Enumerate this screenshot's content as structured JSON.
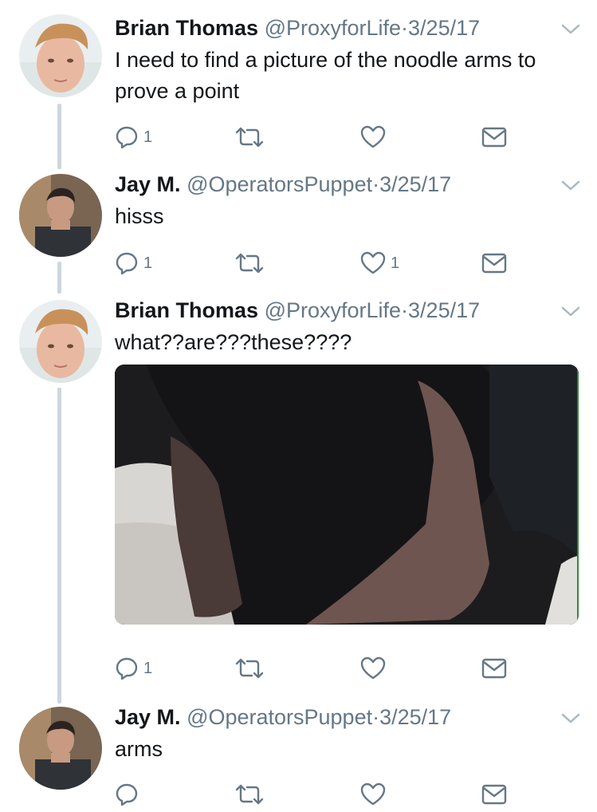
{
  "tweets": [
    {
      "name": "Brian Thomas",
      "handle": "@ProxyforLife",
      "date": "3/25/17",
      "text": "I need to find a picture of the noodle arms to prove a point",
      "replies": "1",
      "retweets": "",
      "likes": ""
    },
    {
      "name": "Jay M.",
      "handle": "@OperatorsPuppet",
      "date": "3/25/17",
      "text": "hisss",
      "replies": "1",
      "retweets": "",
      "likes": "1"
    },
    {
      "name": "Brian Thomas",
      "handle": "@ProxyforLife",
      "date": "3/25/17",
      "text": "what??are???these????",
      "replies": "1",
      "retweets": "",
      "likes": ""
    },
    {
      "name": "Jay M.",
      "handle": "@OperatorsPuppet",
      "date": "3/25/17",
      "text": "arms",
      "replies": "",
      "retweets": "",
      "likes": ""
    }
  ],
  "icons": {
    "reply": "reply-icon",
    "retweet": "retweet-icon",
    "like": "heart-icon",
    "message": "direct-message-icon",
    "menu": "chevron-down-icon"
  },
  "colors": {
    "text": "#14171a",
    "secondary": "#657786",
    "thread": "#ccd6dd"
  },
  "separator": "·"
}
